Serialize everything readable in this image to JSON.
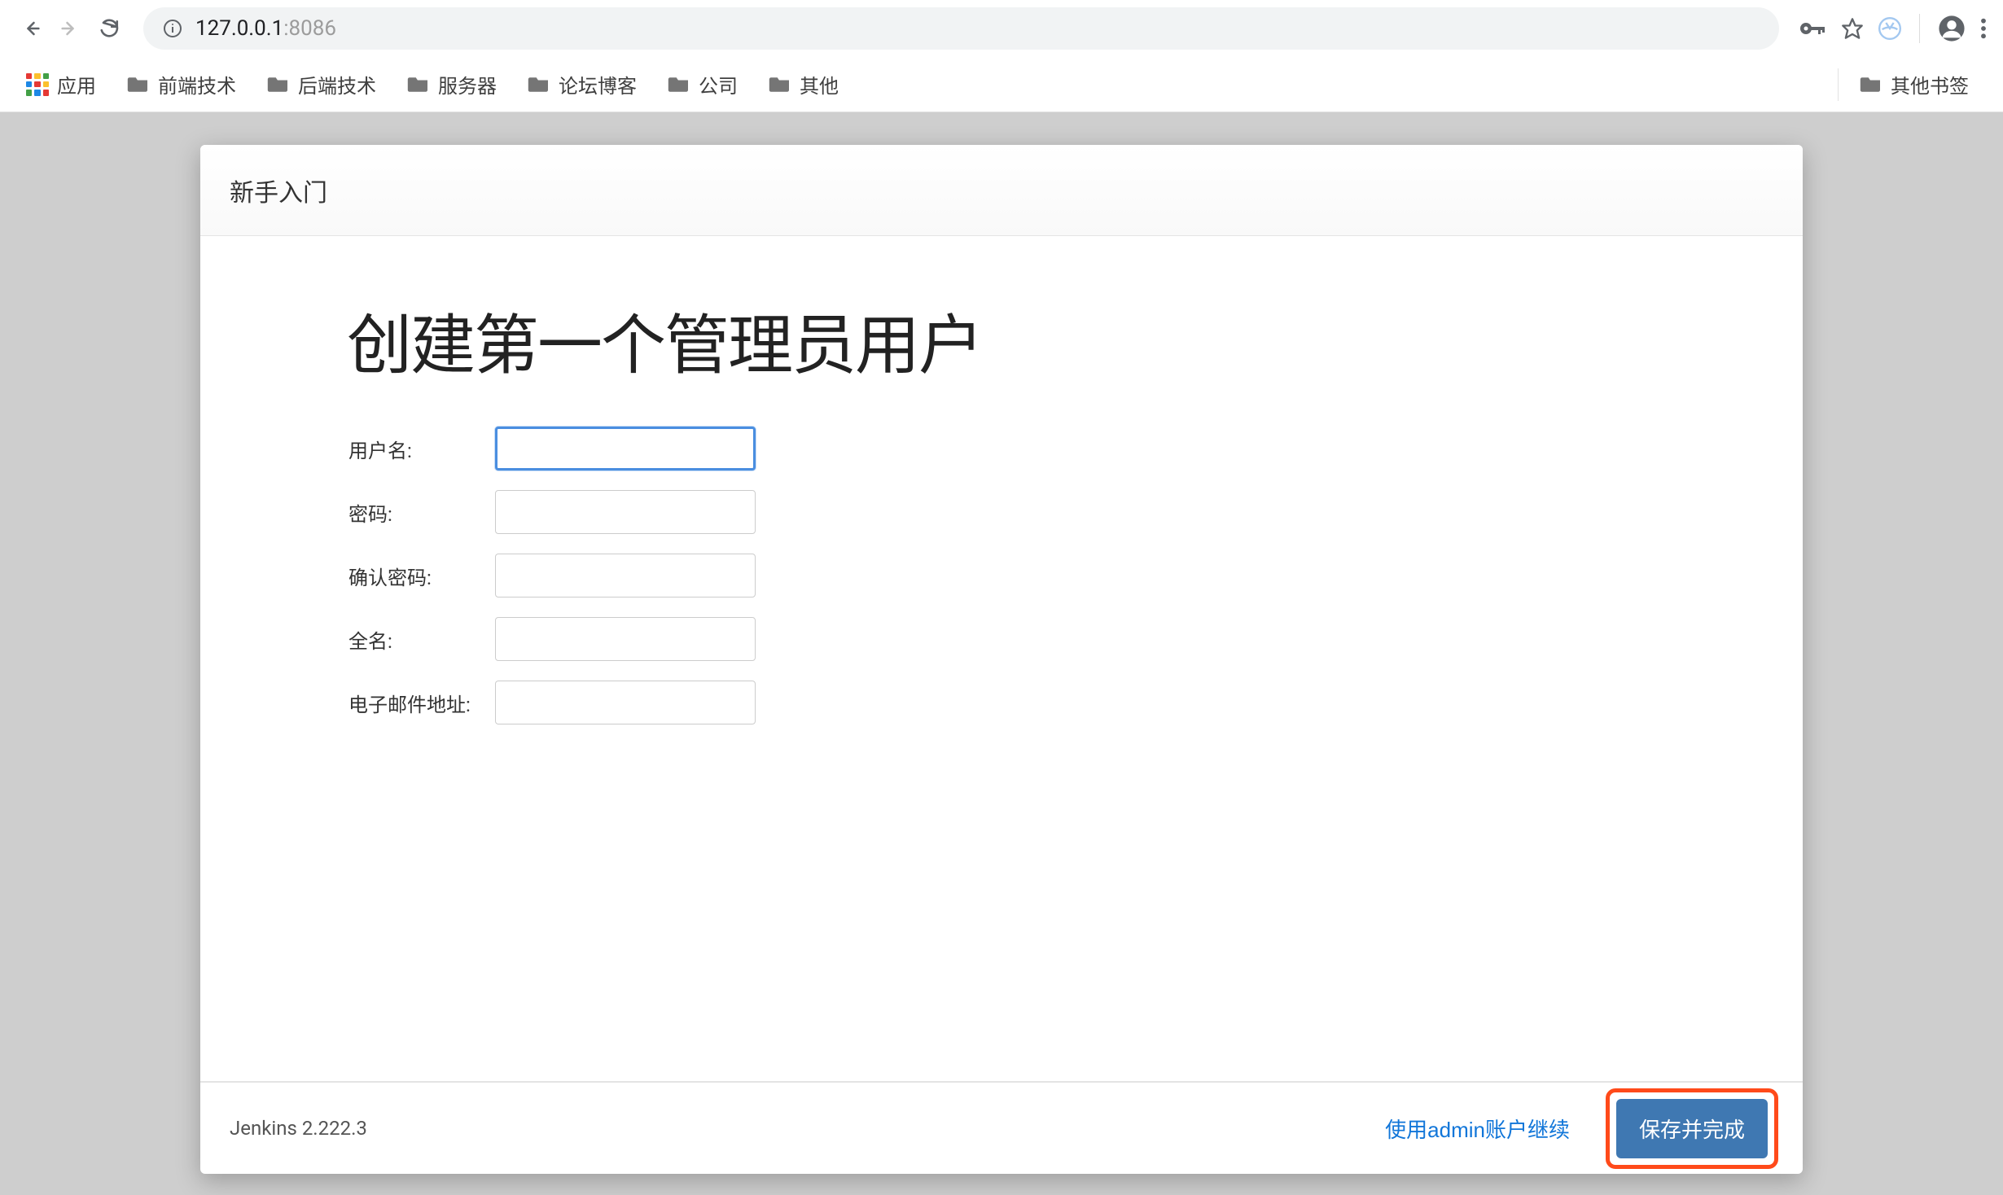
{
  "browser": {
    "url_prefix": "127.0.0.1",
    "url_suffix": ":8086"
  },
  "bookmarks": {
    "apps_label": "应用",
    "items": [
      {
        "label": "前端技术"
      },
      {
        "label": "后端技术"
      },
      {
        "label": "服务器"
      },
      {
        "label": "论坛博客"
      },
      {
        "label": "公司"
      },
      {
        "label": "其他"
      }
    ],
    "other_label": "其他书签"
  },
  "modal": {
    "header_title": "新手入门",
    "heading": "创建第一个管理员用户",
    "fields": {
      "username_label": "用户名:",
      "password_label": "密码:",
      "confirm_password_label": "确认密码:",
      "fullname_label": "全名:",
      "email_label": "电子邮件地址:"
    },
    "footer": {
      "version": "Jenkins 2.222.3",
      "continue_as_admin": "使用admin账户继续",
      "save_and_finish": "保存并完成"
    }
  },
  "colors": {
    "primary_button": "#3f78b2",
    "highlight_border": "#ff4a1a",
    "focus_border": "#4a8ee0",
    "page_bg": "#cecece"
  }
}
